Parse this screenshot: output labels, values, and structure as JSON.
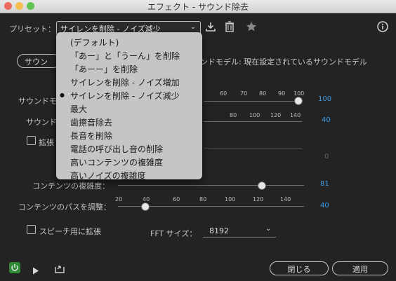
{
  "window": {
    "title": "エフェクト - サウンド除去"
  },
  "preset": {
    "label": "プリセット：",
    "selected": "サイレンを削除 - ノイズ減少",
    "dropdown_arrow": "chevron-down-icon"
  },
  "toolbar": {
    "save_icon": "download-icon",
    "delete_icon": "trash-icon",
    "favorite_icon": "star-icon",
    "info_icon": "info-icon"
  },
  "dropdown": {
    "items": [
      "(デフォルト)",
      "「あー」と「うーん」を削除",
      "「あーー」を削除",
      "サイレンを削除 - ノイズ増加",
      "サイレンを削除 - ノイズ減少",
      "最大",
      "歯擦音除去",
      "長音を削除",
      "電話の呼び出し音の削除",
      "高いコンテンツの複雑度",
      "高いノイズの複雑度"
    ],
    "selected_index": 4
  },
  "tab": {
    "label": "サウン",
    "model_status": "ンドモデル: 現在設定されているサウンドモデル"
  },
  "sliders": {
    "sound_model": {
      "label": "サウンドモ",
      "ticks": [
        "60",
        "70",
        "80",
        "90",
        "100"
      ],
      "value": "100",
      "level": 1.0
    },
    "sound2": {
      "label": "サウンド",
      "ticks": [
        "80",
        "100",
        "120",
        "140"
      ],
      "value": "40"
    },
    "extend_label": "拡張",
    "zero_value": "0",
    "content_complexity": {
      "label": "コンテンツの複雑度：",
      "value": "81",
      "level": 0.81
    },
    "content_pass": {
      "label": "コンテンツのパスを調整：",
      "ticks": [
        "20",
        "40",
        "60",
        "80",
        "100",
        "120",
        "140"
      ],
      "value": "40",
      "level": 0.2
    }
  },
  "speech": {
    "label": "スピーチ用に拡張"
  },
  "fft": {
    "label": "FFT サイズ：",
    "value": "8192"
  },
  "footer": {
    "close_label": "閉じる",
    "apply_label": "適用"
  }
}
